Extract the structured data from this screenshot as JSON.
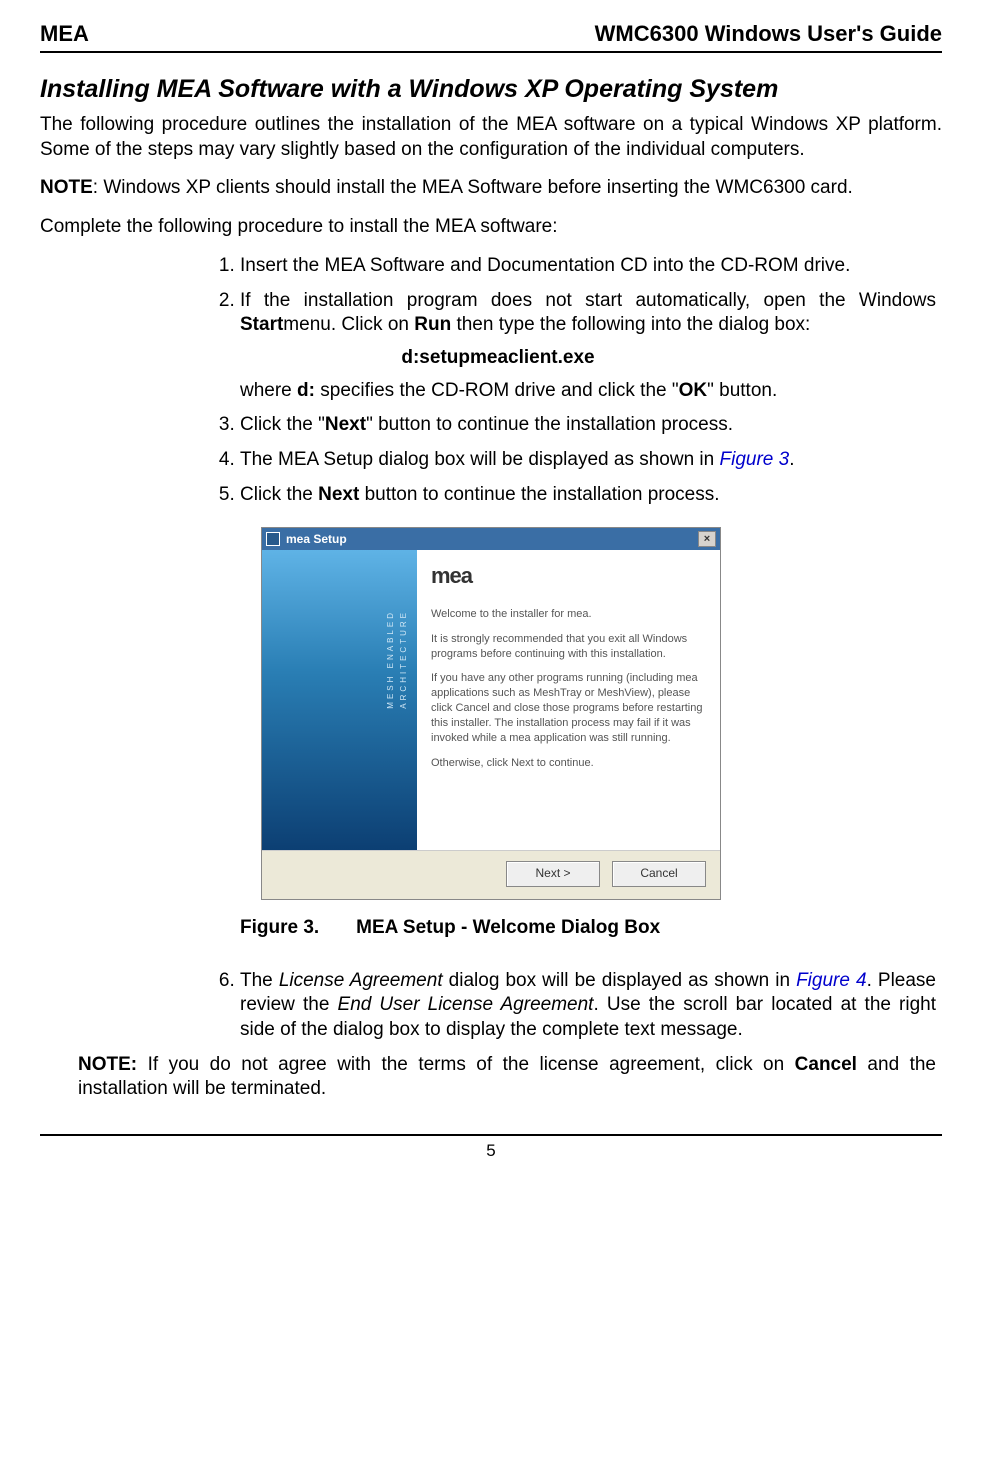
{
  "header": {
    "left": "MEA",
    "right": "WMC6300 Windows User's Guide"
  },
  "section_title": "Installing MEA Software with a Windows XP Operating System",
  "intro_para": "The following procedure outlines the installation of the MEA software on a typical Windows XP platform.  Some of the steps may  vary slightly based on the configuration of the individual computers.",
  "note1": {
    "label": "NOTE",
    "text": ":   Windows XP clients should install the MEA Software  before inserting the WMC6300 card."
  },
  "complete_line": "Complete the following procedure to install the MEA software:",
  "steps": {
    "s1": "Insert the MEA Software and Documentation CD into the CD-ROM drive.",
    "s2a": "If the installation program does not start automatically, open the Windows ",
    "s2_start": "Start",
    "s2b": "menu.  Click on ",
    "s2_run": "Run",
    "s2c": " then type the following into the dialog box:",
    "s2_cmd": "d:setupmeaclient.exe",
    "s2_where_a": "where ",
    "s2_where_d": "d:",
    "s2_where_b": " specifies the CD-ROM drive and click the \"",
    "s2_where_ok": "OK",
    "s2_where_c": "\" button.",
    "s3a": "Click the \"",
    "s3_next": "Next",
    "s3b": "\" button to continue the installation process.",
    "s4a": "The MEA Setup dialog box will be displayed as shown in ",
    "s4_fig": "Figure 3",
    "s4b": ".",
    "s5a": "Click the ",
    "s5_next": "Next",
    "s5b": " button to continue the installation process."
  },
  "dialog": {
    "title": "mea Setup",
    "brand": "mea",
    "sub1": "MESH ENABLED",
    "sub2": "ARCHITECTURE",
    "heading": "mea",
    "p1": "Welcome to the installer for mea.",
    "p2": "It is strongly recommended that you exit all Windows programs before continuing with this installation.",
    "p3": "If you have any other programs running (including mea applications such as MeshTray or MeshView), please click Cancel and close those programs before restarting this installer. The installation process may fail if it was invoked while a mea application was still running.",
    "p4": "Otherwise, click Next to continue.",
    "btn_next": "Next >",
    "btn_cancel": "Cancel"
  },
  "figure_caption": {
    "num": "Figure 3.",
    "text": "MEA Setup - Welcome Dialog Box"
  },
  "step6": {
    "a": "The ",
    "la": "License Agreement",
    "b": " dialog box will be displayed as shown in ",
    "fig": "Figure 4",
    "c": ".  Please review the ",
    "eula": "End User License Agreement",
    "d": ".  Use the scroll bar located at the right side of the dialog box to display the complete text message."
  },
  "note2": {
    "label": "NOTE:",
    "a": "  If you do not agree with the terms of the license agreement, click on ",
    "cancel": "Cancel",
    "b": " and the installation will be terminated."
  },
  "page_number": "5"
}
